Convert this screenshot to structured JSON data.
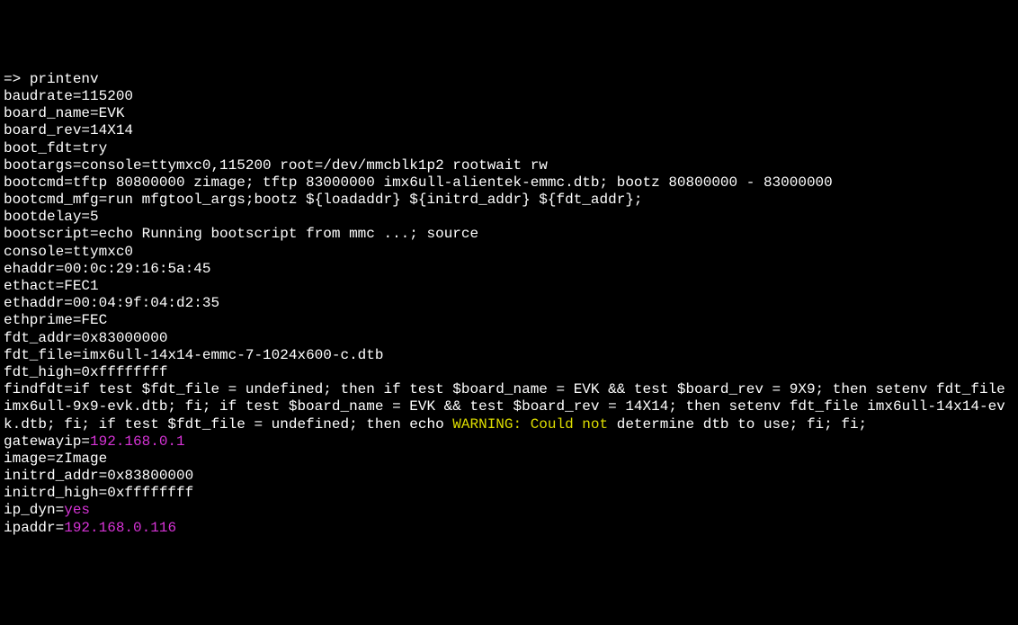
{
  "prompt": "=> ",
  "command": "printenv",
  "env": {
    "baudrate": "115200",
    "board_name": "EVK",
    "board_rev": "14X14",
    "boot_fdt": "try",
    "bootargs": "console=ttymxc0,115200 root=/dev/mmcblk1p2 rootwait rw",
    "bootcmd": "tftp 80800000 zimage; tftp 83000000 imx6ull-alientek-emmc.dtb; bootz 80800000 - 83000000",
    "bootcmd_mfg": "run mfgtool_args;bootz ${loadaddr} ${initrd_addr} ${fdt_addr};",
    "bootdelay": "5",
    "bootscript": "echo Running bootscript from mmc ...; source",
    "console": "ttymxc0",
    "ehaddr": "00:0c:29:16:5a:45",
    "ethact": "FEC1",
    "ethaddr": "00:04:9f:04:d2:35",
    "ethprime": "FEC",
    "fdt_addr": "0x83000000",
    "fdt_file": "imx6ull-14x14-emmc-7-1024x600-c.dtb",
    "fdt_high": "0xffffffff",
    "findfdt_prefix": "if test $fdt_file = undefined; then if test $board_name = EVK && test $board_rev = 9X9; then setenv fdt_file imx6ull-9x9-evk.dtb; fi; if test $board_name = EVK && test $board_rev = 14X14; then setenv fdt_file imx6ull-14x14-evk.dtb; fi; if test $fdt_file = undefined; then echo ",
    "findfdt_warn1": "WARNING:",
    "findfdt_warn2": " Could not",
    "findfdt_suffix": " determine dtb to use; fi; fi;",
    "gatewayip": "192.168.0.1",
    "image": "zImage",
    "initrd_addr": "0x83800000",
    "initrd_high": "0xffffffff",
    "ip_dyn": "yes",
    "ipaddr": "192.168.0.116"
  }
}
